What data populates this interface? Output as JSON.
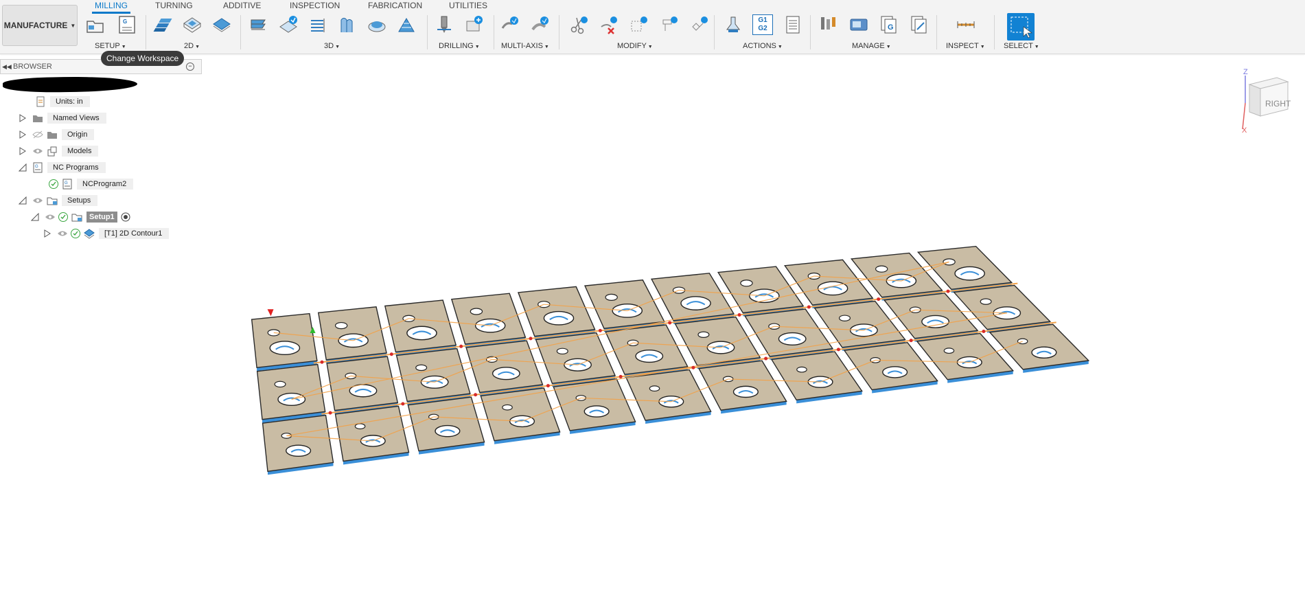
{
  "workspace": {
    "label": "MANUFACTURE"
  },
  "tabs": [
    {
      "label": "MILLING",
      "active": true
    },
    {
      "label": "TURNING"
    },
    {
      "label": "ADDITIVE"
    },
    {
      "label": "INSPECTION"
    },
    {
      "label": "FABRICATION"
    },
    {
      "label": "UTILITIES"
    }
  ],
  "groups": {
    "setup": "SETUP",
    "two_d": "2D",
    "three_d": "3D",
    "drilling": "DRILLING",
    "multi_axis": "MULTI-AXIS",
    "modify": "MODIFY",
    "actions": "ACTIONS",
    "manage": "MANAGE",
    "inspect": "INSPECT",
    "select": "SELECT"
  },
  "actions_icons": {
    "g1g2_line1": "G1",
    "g1g2_line2": "G2"
  },
  "tooltip": "Change Workspace",
  "browser": {
    "title": "BROWSER",
    "nodes": {
      "units": "Units: in",
      "named_views": "Named Views",
      "origin": "Origin",
      "models": "Models",
      "nc_programs": "NC Programs",
      "ncprogram2": "NCProgram2",
      "setups": "Setups",
      "setup1": "Setup1",
      "contour": "[T1] 2D Contour1"
    }
  },
  "viewcube": {
    "face": "RIGHT",
    "axis_z": "Z",
    "axis_x": "X"
  },
  "colors": {
    "accent": "#0a79c9",
    "plate": "#c9bca4",
    "toolpath": "#f2a24a",
    "stock_edge": "#3a8fd8"
  }
}
